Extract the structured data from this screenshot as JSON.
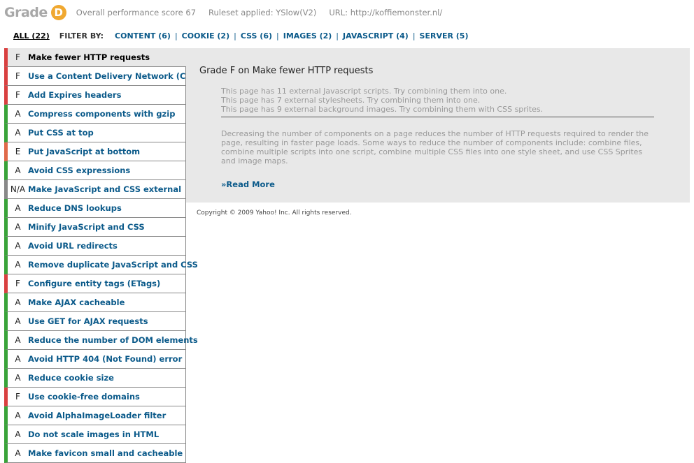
{
  "header": {
    "grade_word": "Grade",
    "grade_letter": "D",
    "grade_color": "#f0a830",
    "score_text": "Overall performance score 67",
    "ruleset_text": "Ruleset applied: YSlow(V2)",
    "url_text": "URL: http://koffiemonster.nl/"
  },
  "filters": {
    "all_label": "ALL (22)",
    "filter_by": "FILTER BY:",
    "items": [
      "CONTENT (6)",
      "COOKIE (2)",
      "CSS (6)",
      "IMAGES (2)",
      "JAVASCRIPT (4)",
      "SERVER (5)"
    ]
  },
  "status_colors": {
    "A": "#39a339",
    "F": "#d94040",
    "E": "#e06a4a",
    "NA": "#888888"
  },
  "rules": [
    {
      "grade": "F",
      "title": "Make fewer HTTP requests",
      "color": "#d94040",
      "selected": true
    },
    {
      "grade": "F",
      "title": "Use a Content Delivery Network (CDN)",
      "color": "#d94040"
    },
    {
      "grade": "F",
      "title": "Add Expires headers",
      "color": "#d94040"
    },
    {
      "grade": "A",
      "title": "Compress components with gzip",
      "color": "#39a339"
    },
    {
      "grade": "A",
      "title": "Put CSS at top",
      "color": "#39a339"
    },
    {
      "grade": "E",
      "title": "Put JavaScript at bottom",
      "color": "#e06a4a"
    },
    {
      "grade": "A",
      "title": "Avoid CSS expressions",
      "color": "#39a339"
    },
    {
      "grade": "N/A",
      "title": "Make JavaScript and CSS external",
      "color": "#888888"
    },
    {
      "grade": "A",
      "title": "Reduce DNS lookups",
      "color": "#39a339"
    },
    {
      "grade": "A",
      "title": "Minify JavaScript and CSS",
      "color": "#39a339"
    },
    {
      "grade": "A",
      "title": "Avoid URL redirects",
      "color": "#39a339"
    },
    {
      "grade": "A",
      "title": "Remove duplicate JavaScript and CSS",
      "color": "#39a339"
    },
    {
      "grade": "F",
      "title": "Configure entity tags (ETags)",
      "color": "#d94040"
    },
    {
      "grade": "A",
      "title": "Make AJAX cacheable",
      "color": "#39a339"
    },
    {
      "grade": "A",
      "title": "Use GET for AJAX requests",
      "color": "#39a339"
    },
    {
      "grade": "A",
      "title": "Reduce the number of DOM elements",
      "color": "#39a339"
    },
    {
      "grade": "A",
      "title": "Avoid HTTP 404 (Not Found) error",
      "color": "#39a339"
    },
    {
      "grade": "A",
      "title": "Reduce cookie size",
      "color": "#39a339"
    },
    {
      "grade": "F",
      "title": "Use cookie-free domains",
      "color": "#d94040"
    },
    {
      "grade": "A",
      "title": "Avoid AlphaImageLoader filter",
      "color": "#39a339"
    },
    {
      "grade": "A",
      "title": "Do not scale images in HTML",
      "color": "#39a339"
    },
    {
      "grade": "A",
      "title": "Make favicon small and cacheable",
      "color": "#39a339"
    }
  ],
  "detail": {
    "heading": "Grade F on Make fewer HTTP requests",
    "messages": [
      "This page has 11 external Javascript scripts. Try combining them into one.",
      "This page has 7 external stylesheets. Try combining them into one.",
      "This page has 9 external background images. Try combining them with CSS sprites."
    ],
    "description": "Decreasing the number of components on a page reduces the number of HTTP requests required to render the page, resulting in faster page loads. Some ways to reduce the number of components include: combine files, combine multiple scripts into one script, combine multiple CSS files into one style sheet, and use CSS Sprites and image maps.",
    "read_more": "»Read More"
  },
  "footer": {
    "copyright": "Copyright © 2009 Yahoo! Inc. All rights reserved."
  }
}
